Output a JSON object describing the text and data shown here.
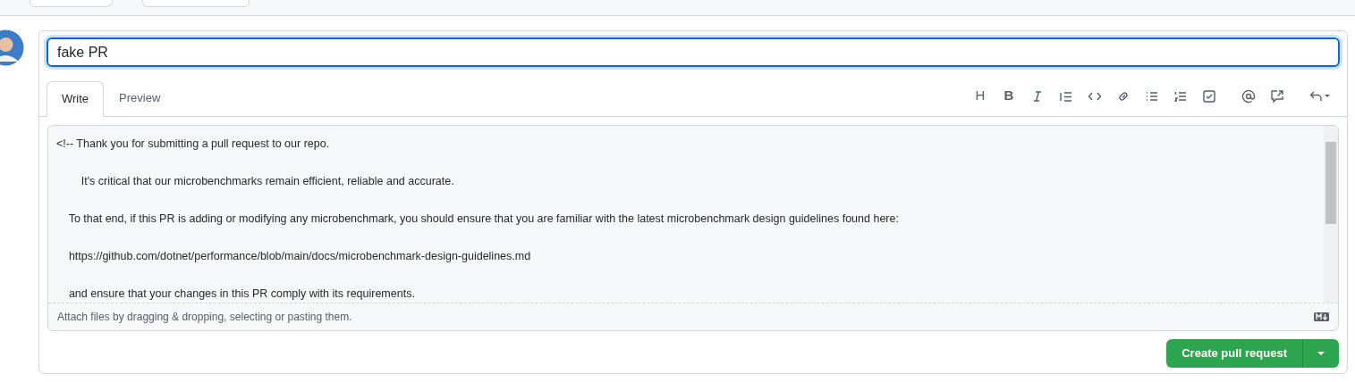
{
  "title_field": {
    "value": "fake PR"
  },
  "tabs": [
    {
      "label": "Write",
      "selected": true
    },
    {
      "label": "Preview",
      "selected": false
    }
  ],
  "toolbar": [
    {
      "kind": "heading",
      "label": "H"
    },
    {
      "kind": "bold",
      "label": "B"
    },
    {
      "kind": "italic"
    },
    {
      "kind": "quote"
    },
    {
      "kind": "code"
    },
    {
      "kind": "link"
    },
    {
      "kind": "bullets"
    },
    {
      "kind": "numbers"
    },
    {
      "kind": "task"
    },
    {
      "kind": "gap"
    },
    {
      "kind": "mention"
    },
    {
      "kind": "reference"
    },
    {
      "kind": "gap"
    },
    {
      "kind": "reply"
    }
  ],
  "body_lines": [
    "<!-- Thank you for submitting a pull request to our repo.",
    "        It's critical that our microbenchmarks remain efficient, reliable and accurate.",
    "    To that end, if this PR is adding or modifying any microbenchmark, you should ensure that you are familiar with the latest microbenchmark design guidelines found here:",
    "    https://github.com/dotnet/performance/blob/main/docs/microbenchmark-design-guidelines.md",
    "    and ensure that your changes in this PR comply with its requirements."
  ],
  "attach_hint": "Attach files by dragging & dropping, selecting or pasting them.",
  "submit_button": {
    "label": "Create pull request"
  }
}
